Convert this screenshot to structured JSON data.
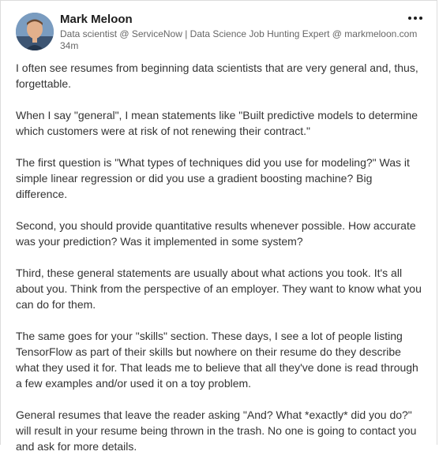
{
  "author": {
    "name": "Mark Meloon",
    "headline": "Data scientist @ ServiceNow | Data Science Job Hunting Expert @ markmeloon.com",
    "time": "34m"
  },
  "menu": {
    "icon": "more-horizontal-icon"
  },
  "post": {
    "paragraphs": [
      "I often see resumes from beginning data scientists that are very general and, thus, forgettable.",
      "When I say \"general\", I mean statements like \"Built predictive models to determine which customers were at risk of not renewing their contract.\"",
      "The first question is \"What types of techniques did you use for modeling?\" Was it simple linear regression or did you use a gradient boosting machine? Big difference.",
      "Second, you should provide quantitative results whenever possible. How accurate was your prediction? Was it implemented in some system?",
      "Third, these general statements are usually about what actions you took. It's all about you. Think from the perspective of an employer. They want to know what you can do for them.",
      "The same goes for your \"skills\" section. These days, I see a lot of people listing TensorFlow as part of their skills but nowhere on their resume do they describe what they used it for. That leads me to believe that all they've done is read through a few examples and/or used it on a toy problem.",
      "General resumes that leave the reader asking \"And? What *exactly* did you do?\" will result in your resume being thrown in the trash. No one is going to contact you and ask for more details."
    ]
  }
}
